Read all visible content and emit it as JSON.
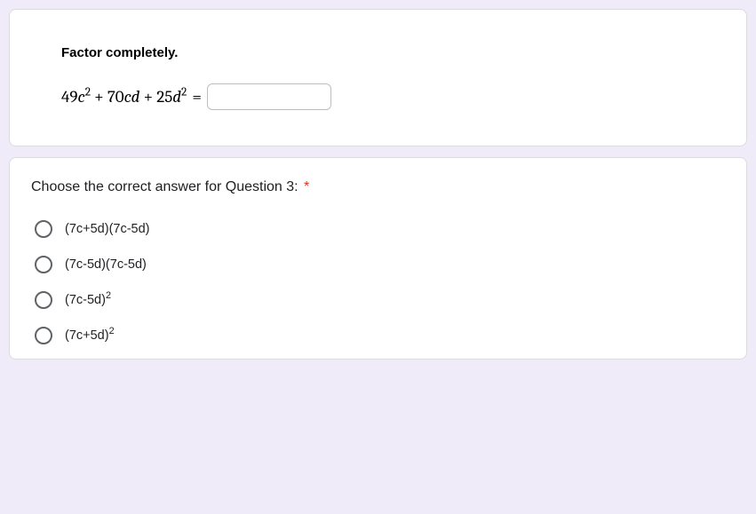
{
  "card1": {
    "prompt": "Factor completely.",
    "math_terms": {
      "t1": "49",
      "v1": "c",
      "e1": "2",
      "p1": " + ",
      "t2": "70",
      "v2": "cd",
      "p2": " + ",
      "t3": "25",
      "v3": "d",
      "e3": "2",
      "eq": "="
    },
    "answer_value": ""
  },
  "card2": {
    "title": "Choose the correct answer for Question 3:",
    "required": "*",
    "options": [
      {
        "base": "(7c+5d)(7c-5d)",
        "sup": ""
      },
      {
        "base": "(7c-5d)(7c-5d)",
        "sup": ""
      },
      {
        "base": "(7c-5d)",
        "sup": "2"
      },
      {
        "base": "(7c+5d)",
        "sup": "2"
      }
    ]
  }
}
